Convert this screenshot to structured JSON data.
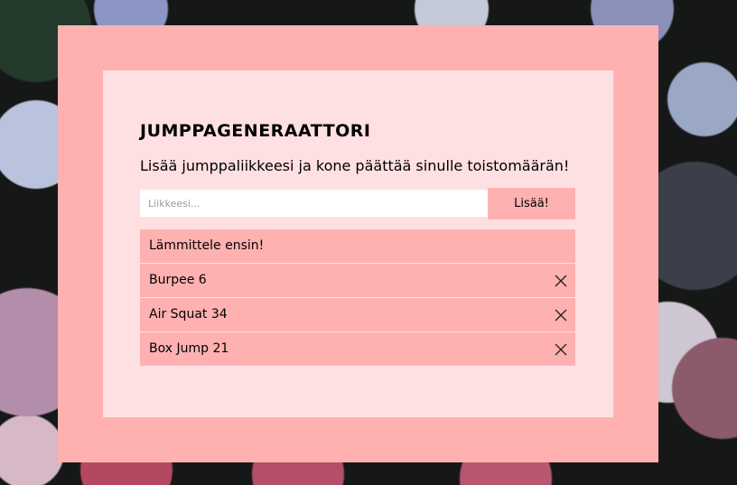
{
  "app": {
    "title": "JUMPPAGENERAATTORI",
    "subtitle": "Lisää jumppaliikkeesi ja kone päättää sinulle toistomäärän!"
  },
  "form": {
    "input_placeholder": "Liikkeesi...",
    "input_value": "",
    "add_button_label": "Lisää!"
  },
  "moves": [
    {
      "text": "Lämmittele ensin!",
      "deletable": false
    },
    {
      "text": "Burpee 6",
      "deletable": true,
      "delete_icon": "close-icon"
    },
    {
      "text": "Air Squat 34",
      "deletable": true,
      "delete_icon": "close-icon"
    },
    {
      "text": "Box Jump 21",
      "deletable": true,
      "delete_icon": "close-icon"
    }
  ],
  "colors": {
    "outer_panel": "#ffb1b1",
    "inner_panel": "#ffe0e2",
    "list_item": "#ffb1b1",
    "button": "#ffb1b1"
  }
}
